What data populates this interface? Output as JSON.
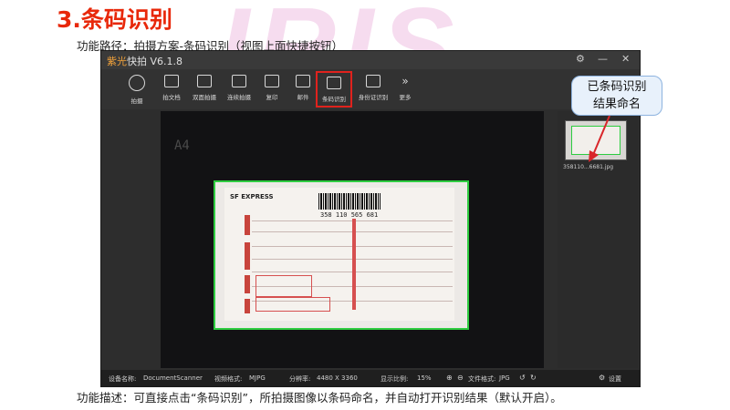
{
  "slide": {
    "title": "3.条码识别",
    "path_line": "功能路径：拍摄方案-条码识别（视图上面快捷按钮）",
    "description": "功能描述：可直接点击“条码识别”，所拍摄图像以条码命名，并自动打开识别结果（默认开启）。",
    "watermark": "IRIS"
  },
  "app": {
    "brand": "紫光",
    "title": "快拍 V6.1.8",
    "window_controls": [
      "⚙",
      "—",
      "✕"
    ],
    "toolbar": [
      {
        "label": "拍摄",
        "icon": "camera-icon"
      },
      {
        "label": "拍文档",
        "icon": "document-icon"
      },
      {
        "label": "双面拍摄",
        "icon": "duplex-icon"
      },
      {
        "label": "连续拍摄",
        "icon": "burst-icon"
      },
      {
        "label": "复印",
        "icon": "copy-icon"
      },
      {
        "label": "邮件",
        "icon": "mail-icon"
      },
      {
        "label": "条码识别",
        "icon": "barcode-icon"
      },
      {
        "label": "身份证识别",
        "icon": "id-card-icon"
      },
      {
        "label": "更多",
        "icon": "more-icon"
      }
    ],
    "canvas": {
      "page_marker": "A4",
      "document": {
        "logo_text": "SF EXPRESS",
        "barcode_number": "358 110 565 681"
      }
    },
    "thumbnail": {
      "filename": "358110...6681.jpg"
    },
    "status_bar": {
      "device_label": "设备名称:",
      "device_value": "DocumentScanner",
      "video_format_label": "视频格式:",
      "video_format_value": "MJPG",
      "resolution_label": "分辨率:",
      "resolution_value": "4480 X 3360",
      "scale_label": "显示比例:",
      "scale_value": "15%",
      "file_format_label": "文件格式:",
      "file_format_value": "JPG",
      "settings_label": "设置"
    }
  },
  "callout": {
    "text_line1": "已条码识别",
    "text_line2": "结果命名"
  },
  "colors": {
    "title_red": "#e8280a",
    "highlight_red": "#e0221d",
    "scan_border_green": "#2ecc40",
    "brand_orange": "#f2a23a"
  }
}
